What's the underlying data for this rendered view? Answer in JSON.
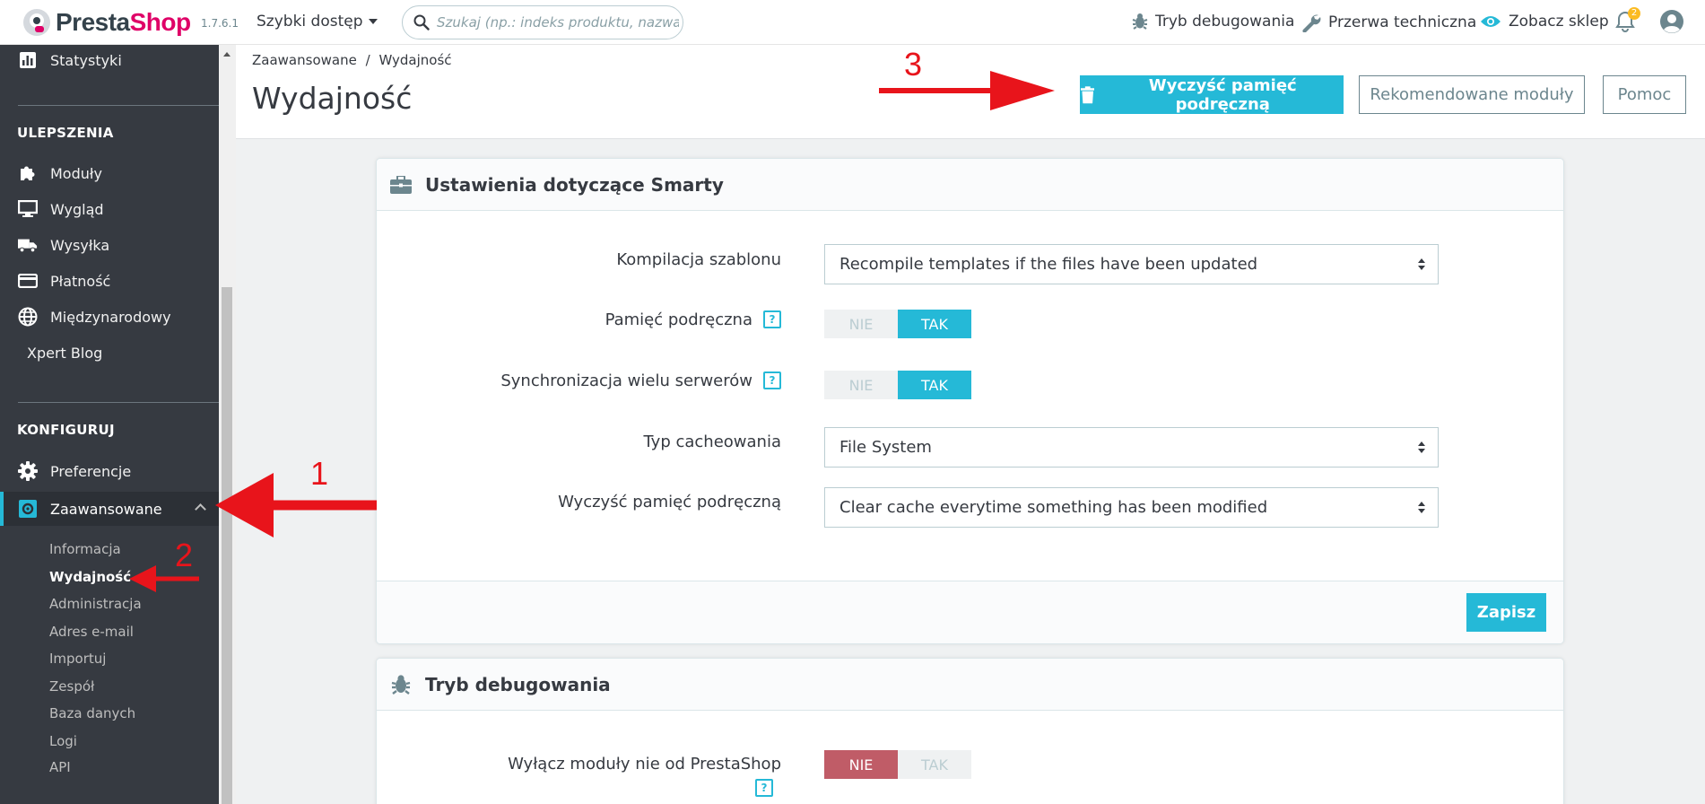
{
  "header": {
    "logo_presta": "Presta",
    "logo_shop": "Shop",
    "version": "1.7.6.1",
    "quick_access": "Szybki dostęp",
    "search_placeholder": "Szukaj (np.: indeks produktu, nazwa klie",
    "debug_mode": "Tryb debugowania",
    "maintenance": "Przerwa techniczna",
    "view_shop": "Zobacz sklep",
    "notifications_count": "2"
  },
  "sidebar": {
    "top_item": "Statystyki",
    "section_improve": "ULEPSZENIA",
    "improve_items": [
      "Moduły",
      "Wygląd",
      "Wysyłka",
      "Płatność",
      "Międzynarodowy"
    ],
    "xpert_blog": "Xpert Blog",
    "section_configure": "KONFIGURUJ",
    "preferences": "Preferencje",
    "advanced": "Zaawansowane",
    "sub_items": [
      "Informacja",
      "Wydajność",
      "Administracja",
      "Adres e-mail",
      "Importuj",
      "Zespół",
      "Baza danych",
      "Logi",
      "API"
    ]
  },
  "page": {
    "breadcrumb_parent": "Zaawansowane",
    "breadcrumb_sep": "/",
    "breadcrumb_current": "Wydajność",
    "title": "Wydajność",
    "btn_clear_cache": "Wyczyść pamięć podręczną",
    "btn_recommended": "Rekomendowane moduły",
    "btn_help": "Pomoc"
  },
  "smarty_card": {
    "title": "Ustawienia dotyczące Smarty",
    "template_compilation_label": "Kompilacja szablonu",
    "template_compilation_value": "Recompile templates if the files have been updated",
    "cache_label": "Pamięć podręczna",
    "multi_server_label": "Synchronizacja wielu serwerów",
    "cache_type_label": "Typ cacheowania",
    "cache_type_value": "File System",
    "clear_cache_label": "Wyczyść pamięć podręczną",
    "clear_cache_value": "Clear cache everytime something has been modified",
    "switch_no": "NIE",
    "switch_yes": "TAK",
    "help_mark": "?",
    "save": "Zapisz"
  },
  "debug_card": {
    "title": "Tryb debugowania",
    "disable_non_native_label": "Wyłącz moduły nie od PrestaShop",
    "switch_no": "NIE",
    "switch_yes": "TAK",
    "help_mark": "?"
  },
  "annotations": [
    "1",
    "2",
    "3"
  ],
  "colors": {
    "accent": "#25b9d7",
    "sidebar_bg": "#363a41",
    "annotation_red": "#e8141b",
    "switch_no_active": "#c05c67"
  }
}
